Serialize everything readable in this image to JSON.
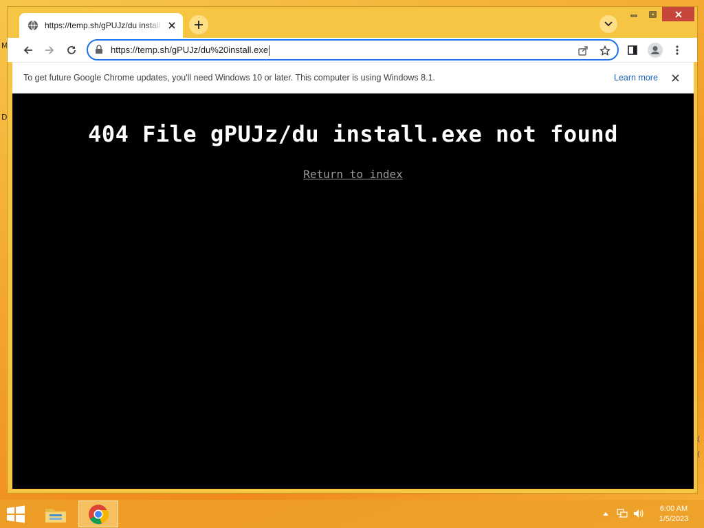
{
  "window": {
    "tab_title": "https://temp.sh/gPUJz/du install.exe",
    "url": "https://temp.sh/gPUJz/du%20install.exe"
  },
  "infobar": {
    "message": "To get future Google Chrome updates, you'll need Windows 10 or later. This computer is using Windows 8.1.",
    "learn_more": "Learn more"
  },
  "page": {
    "heading": "404 File gPUJz/du install.exe not found",
    "return_link": "Return to index"
  },
  "taskbar": {
    "time": "6:00 AM",
    "date": "1/5/2023"
  },
  "desktop": {
    "edge_glyphs": [
      "M",
      "D",
      "(",
      "("
    ]
  },
  "colors": {
    "accent": "#1a73e8",
    "window_frame": "#f6c544",
    "close_button": "#c7463b",
    "page_background": "#000000",
    "heading_text": "#ffffff",
    "link_text": "#9a9a9a"
  },
  "icons": {
    "tab_favicon": "globe-icon",
    "tab_close": "close-icon",
    "new_tab": "plus-icon",
    "tab_search": "chevron-down-icon",
    "back": "back-arrow-icon",
    "forward": "forward-arrow-icon",
    "reload": "reload-icon",
    "lock": "lock-icon",
    "share": "share-icon",
    "bookmark": "star-icon",
    "side_panel": "side-panel-icon",
    "profile": "profile-icon",
    "menu": "kebab-menu-icon"
  }
}
